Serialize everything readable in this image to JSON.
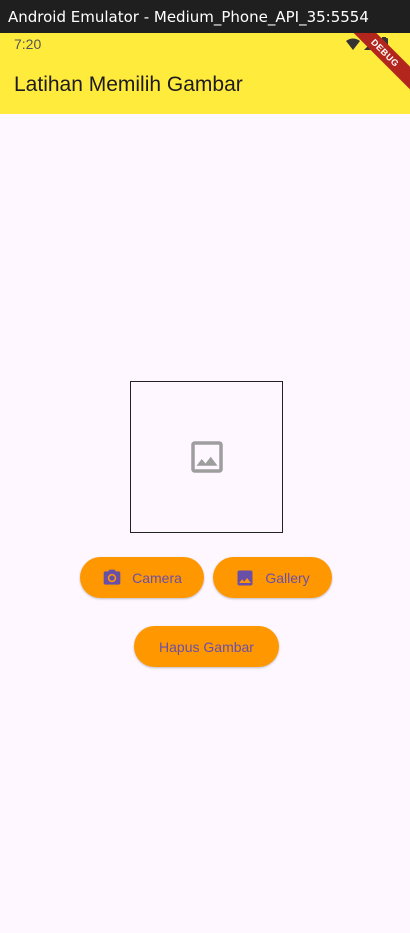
{
  "window": {
    "title": "Android Emulator - Medium_Phone_API_35:5554"
  },
  "status_bar": {
    "time": "7:20"
  },
  "app_bar": {
    "title": "Latihan Memilih Gambar",
    "debug_label": "DEBUG"
  },
  "image_placeholder": {
    "icon": "image-icon"
  },
  "buttons": {
    "camera": {
      "label": "Camera",
      "icon": "camera-icon"
    },
    "gallery": {
      "label": "Gallery",
      "icon": "gallery-icon"
    },
    "delete": {
      "label": "Hapus Gambar"
    }
  },
  "colors": {
    "app_bar": "#ffeb3b",
    "button": "#ff9800",
    "button_text": "#6a4fa8",
    "background": "#fef7ff"
  }
}
